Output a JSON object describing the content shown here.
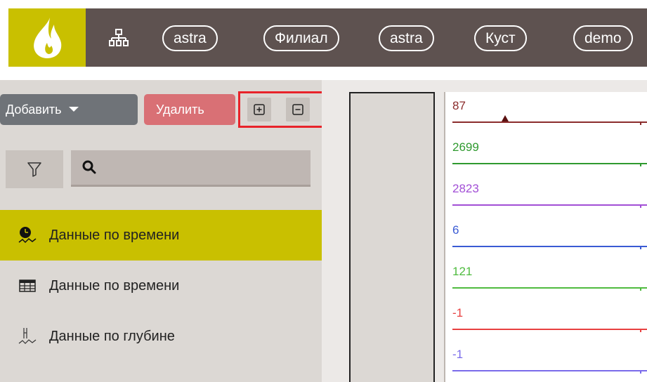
{
  "header": {
    "org_icon": "org-chart-icon",
    "breadcrumbs": [
      "astra",
      "Филиал",
      "astra",
      "Куст",
      "demo"
    ]
  },
  "toolbar": {
    "add_label": "Добавить",
    "delete_label": "Удалить",
    "expand_icon": "plus-square-icon",
    "collapse_icon": "minus-square-icon"
  },
  "search": {
    "filter_icon": "filter-icon",
    "search_icon": "search-icon",
    "value": ""
  },
  "list": {
    "items": [
      {
        "label": "Данные по времени",
        "icon": "time-chart-icon",
        "active": true
      },
      {
        "label": "Данные по времени",
        "icon": "table-icon",
        "active": false
      },
      {
        "label": "Данные по глубине",
        "icon": "depth-chart-icon",
        "active": false
      }
    ]
  },
  "tracks": [
    {
      "value": "87",
      "color": "#8b2c2c"
    },
    {
      "value": "2699",
      "color": "#2f9a2f"
    },
    {
      "value": "2823",
      "color": "#a24fd6"
    },
    {
      "value": "6",
      "color": "#3a5bd4"
    },
    {
      "value": "121",
      "color": "#4fbb3f"
    },
    {
      "value": "-1",
      "color": "#e84040"
    },
    {
      "value": "-1",
      "color": "#7a6bea"
    }
  ],
  "colors": {
    "accent": "#c9c000",
    "topbar": "#5e5250",
    "add_button": "#6f7378",
    "delete_button": "#d97075",
    "highlight": "#e8232a"
  }
}
